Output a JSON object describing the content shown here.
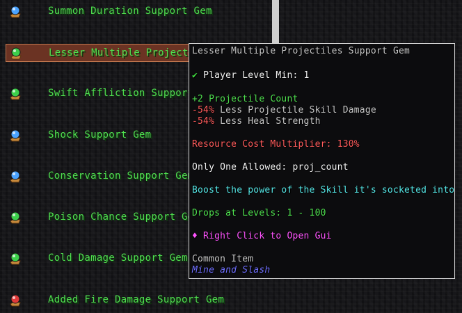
{
  "gem_list": [
    {
      "label": "Summon Duration Support Gem",
      "gem_color": "#4aa3ff",
      "icon": "blue-gem-icon"
    },
    {
      "label": "Lesser Multiple Projectiles Support Gem",
      "gem_color": "#3ccf4a",
      "icon": "green-gem-icon",
      "selected": true
    },
    {
      "label": "Swift Affliction Support Gem",
      "gem_color": "#3ccf4a",
      "icon": "green-gem-icon"
    },
    {
      "label": "Shock Support Gem",
      "gem_color": "#4aa3ff",
      "icon": "blue-gem-icon"
    },
    {
      "label": "Conservation Support Gem",
      "gem_color": "#4aa3ff",
      "icon": "blue-gem-icon"
    },
    {
      "label": "Poison Chance Support Gem",
      "gem_color": "#3ccf4a",
      "icon": "green-gem-icon"
    },
    {
      "label": "Cold Damage Support Gem",
      "gem_color": "#3ccf4a",
      "icon": "green-gem-icon"
    },
    {
      "label": "Added Fire Damage Support Gem",
      "gem_color": "#e03a3a",
      "icon": "red-gem-icon"
    }
  ],
  "tooltip": {
    "title": "Lesser Multiple Projectiles Support Gem",
    "level_check": "✔",
    "level_req": "Player Level Min: 1",
    "stat_1": "+2 Projectile Count",
    "stat_2_value": "-54%",
    "stat_2_text": " Less Projectile Skill Damage",
    "stat_3_value": "-54%",
    "stat_3_text": " Less Heal Strength",
    "cost": "Resource Cost Multiplier: 130%",
    "unique": "Only One Allowed: proj_count",
    "description": "Boost the power of the Skill it's socketed into.",
    "drops": "Drops at Levels: 1 - 100",
    "action": "♦ Right Click to Open Gui",
    "rarity": "Common Item",
    "mod": "Mine and Slash"
  },
  "colors": {
    "list_text": "#4ee04e",
    "selected_bg": "#6b3323",
    "tooltip_border": "#d8d8d8"
  }
}
